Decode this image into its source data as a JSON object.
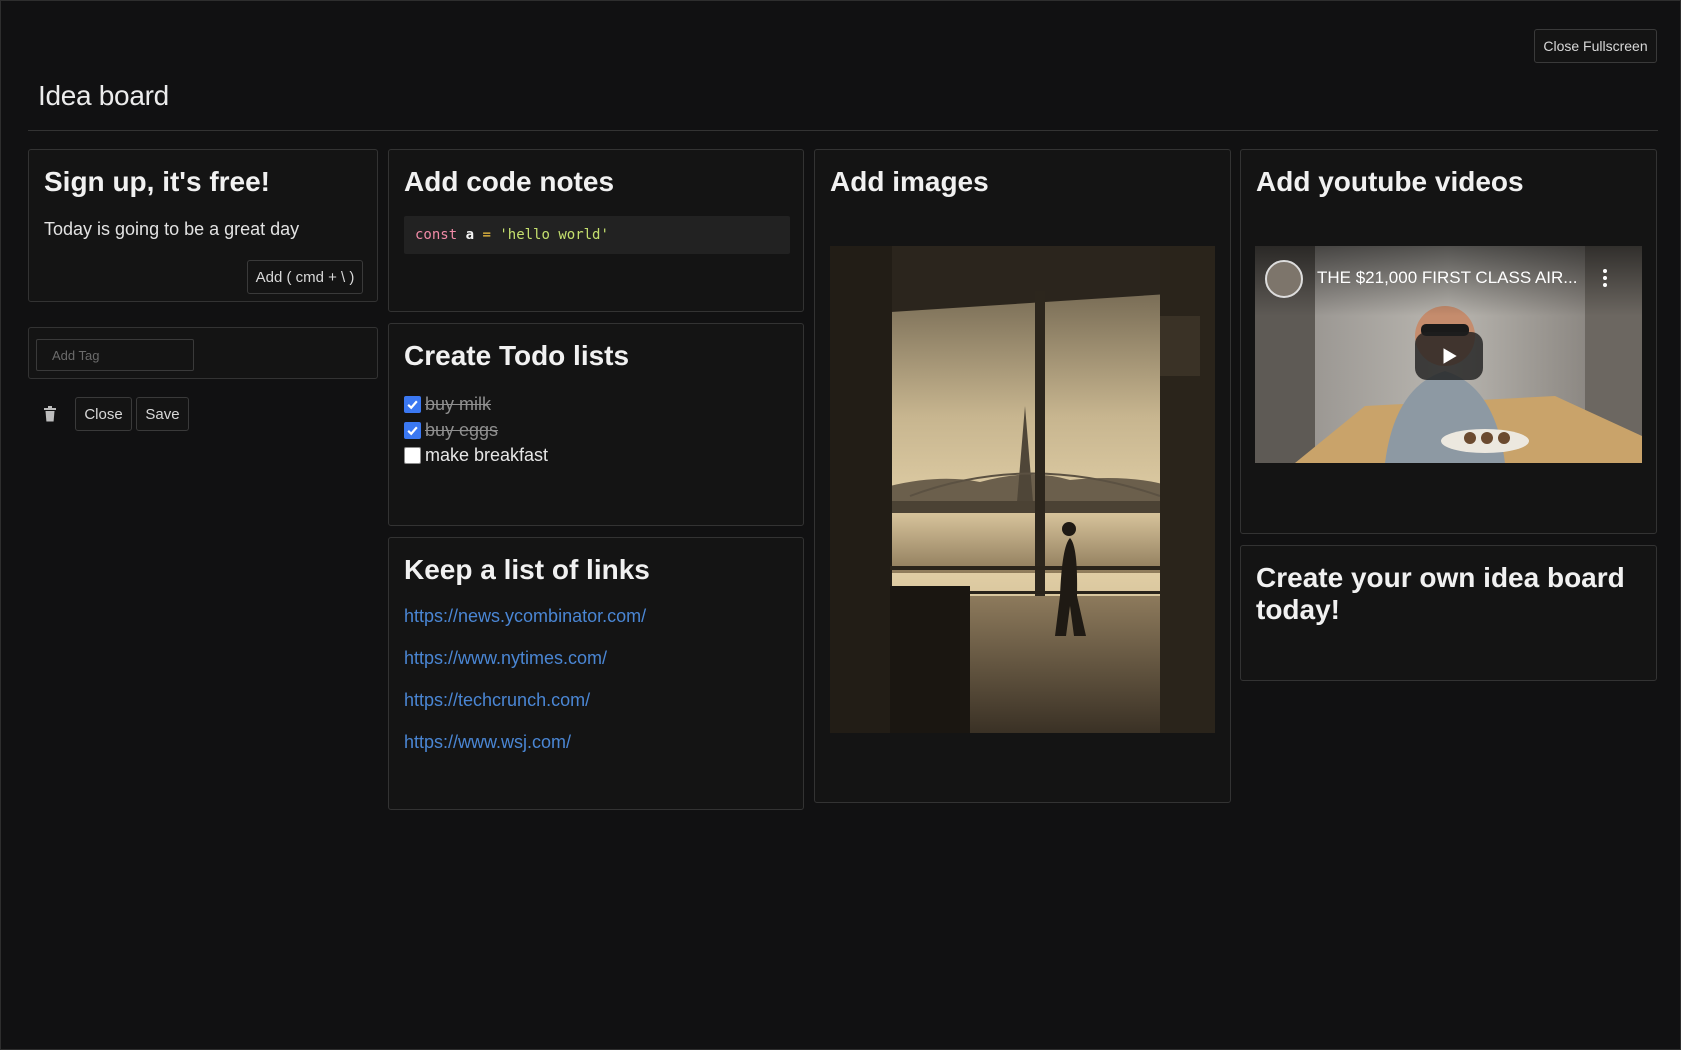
{
  "window": {
    "close_fullscreen_label": "Close Fullscreen"
  },
  "board": {
    "title": "Idea board"
  },
  "signup_card": {
    "title": "Sign up, it's free!",
    "text": "Today is going to be a great day",
    "add_button_label": "Add ( cmd + \\ )"
  },
  "tag_panel": {
    "placeholder": "Add Tag"
  },
  "editor_actions": {
    "close_label": "Close",
    "save_label": "Save",
    "trash_icon": "trash-icon"
  },
  "code_card": {
    "title": "Add code notes",
    "code": {
      "keyword": "const",
      "variable": "a",
      "operator": "=",
      "string": "'hello world'"
    }
  },
  "todo_card": {
    "title": "Create Todo lists",
    "items": [
      {
        "label": "buy milk",
        "checked": true
      },
      {
        "label": "buy eggs",
        "checked": true
      },
      {
        "label": "make breakfast",
        "checked": false
      }
    ]
  },
  "links_card": {
    "title": "Keep a list of links",
    "links": [
      "https://news.ycombinator.com/",
      "https://www.nytimes.com/",
      "https://techcrunch.com/",
      "https://www.wsj.com/"
    ]
  },
  "images_card": {
    "title": "Add images"
  },
  "youtube_card": {
    "title": "Add youtube videos",
    "video_title": "THE $21,000 FIRST CLASS AIR..."
  },
  "cta_card": {
    "title": "Create your own idea board today!"
  },
  "colors": {
    "background": "#111112",
    "card_border": "#333333",
    "link": "#4a86d4",
    "checkbox": "#3b78f2"
  }
}
